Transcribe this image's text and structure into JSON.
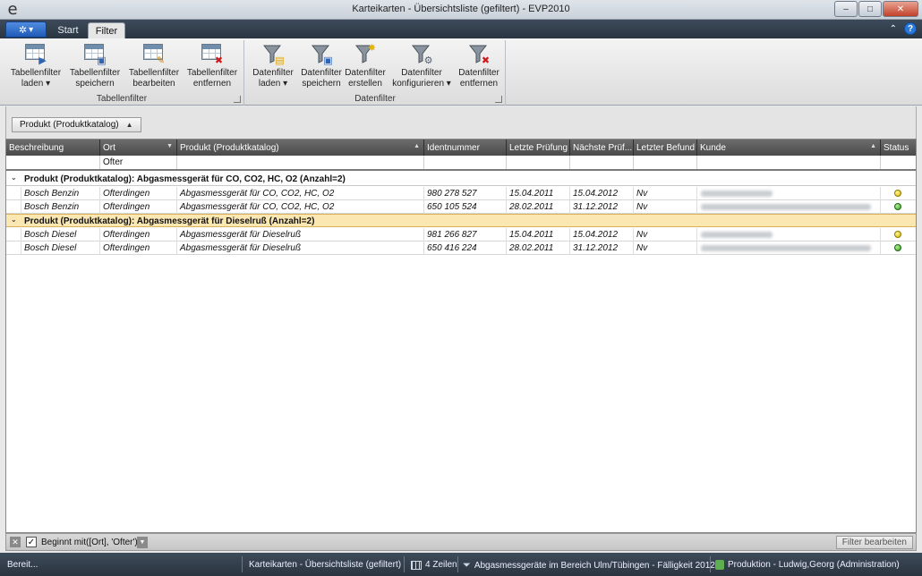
{
  "window": {
    "title": "Karteikarten - Übersichtsliste (gefiltert) - EVP2010",
    "logo": "e",
    "minimize": "–",
    "maximize": "□",
    "close": "✕"
  },
  "tabs": {
    "app_menu": "▾",
    "start": "Start",
    "filter": "Filter",
    "collapse": "⌃",
    "help": "?"
  },
  "ribbon": {
    "groups": [
      {
        "label": "Tabellenfilter",
        "buttons": [
          {
            "label": "Tabellenfilter\nladen ▾",
            "icon": "table-load-icon"
          },
          {
            "label": "Tabellenfilter\nspeichern",
            "icon": "table-save-icon"
          },
          {
            "label": "Tabellenfilter\nbearbeiten",
            "icon": "table-edit-icon"
          },
          {
            "label": "Tabellenfilter\nentfernen",
            "icon": "table-remove-icon"
          }
        ]
      },
      {
        "label": "Datenfilter",
        "buttons": [
          {
            "label": "Datenfilter\nladen ▾",
            "icon": "funnel-load-icon"
          },
          {
            "label": "Datenfilter\nspeichern",
            "icon": "funnel-save-icon"
          },
          {
            "label": "Datenfilter\nerstellen",
            "icon": "funnel-create-icon"
          },
          {
            "label": "Datenfilter\nkonfigurieren ▾",
            "icon": "funnel-configure-icon"
          },
          {
            "label": "Datenfilter\nentfernen",
            "icon": "funnel-remove-icon"
          }
        ]
      }
    ]
  },
  "groupby": {
    "chip_label": "Produkt (Produktkatalog)",
    "chip_sort": "▲"
  },
  "grid": {
    "columns": [
      "Beschreibung",
      "Ort",
      "Produkt (Produktkatalog)",
      "Identnummer",
      "Letzte Prüfung",
      "Nächste Prüf...",
      "Letzter Befund",
      "Kunde",
      "Status"
    ],
    "filter_row": {
      "ort": "Ofter"
    },
    "groups": [
      {
        "label": "Produkt (Produktkatalog): Abgasmessgerät für CO, CO2, HC, O2 (Anzahl=2)",
        "rows": [
          {
            "beschreibung": "Bosch Benzin",
            "ort": "Ofterdingen",
            "produkt": "Abgasmessgerät für CO, CO2, HC, O2",
            "identnummer": "980 278 527",
            "letzte": "15.04.2011",
            "naechste": "15.04.2012",
            "befund": "Nv",
            "status": "yellow"
          },
          {
            "beschreibung": "Bosch Benzin",
            "ort": "Ofterdingen",
            "produkt": "Abgasmessgerät für CO, CO2, HC, O2",
            "identnummer": "650 105 524",
            "letzte": "28.02.2011",
            "naechste": "31.12.2012",
            "befund": "Nv",
            "status": "green"
          }
        ]
      },
      {
        "label": "Produkt (Produktkatalog): Abgasmessgerät für Dieselruß (Anzahl=2)",
        "rows": [
          {
            "beschreibung": "Bosch Diesel",
            "ort": "Ofterdingen",
            "produkt": "Abgasmessgerät für Dieselruß",
            "identnummer": "981 266 827",
            "letzte": "15.04.2011",
            "naechste": "15.04.2012",
            "befund": "Nv",
            "status": "yellow"
          },
          {
            "beschreibung": "Bosch Diesel",
            "ort": "Ofterdingen",
            "produkt": "Abgasmessgerät für Dieselruß",
            "identnummer": "650 416 224",
            "letzte": "28.02.2011",
            "naechste": "31.12.2012",
            "befund": "Nv",
            "status": "green"
          }
        ]
      }
    ],
    "colors": {
      "status_yellow": "#d8b400",
      "status_green": "#2e9e1a",
      "selected_group": "#fbe7b2"
    }
  },
  "filterbar": {
    "close": "✕",
    "check": "✓",
    "expression": "Beginnt mit([Ort], 'Ofter')",
    "dropdown": "▼",
    "edit_button": "Filter bearbeiten"
  },
  "statusbar": {
    "ready": "Bereit...",
    "view": "Karteikarten - Übersichtsliste (gefiltert)",
    "rows": "4 Zeilen",
    "filter": "Abgasmessgeräte im Bereich Ulm/Tübingen - Fälligkeit 2012",
    "database": "Produktion - Ludwig,Georg (Administration)"
  }
}
